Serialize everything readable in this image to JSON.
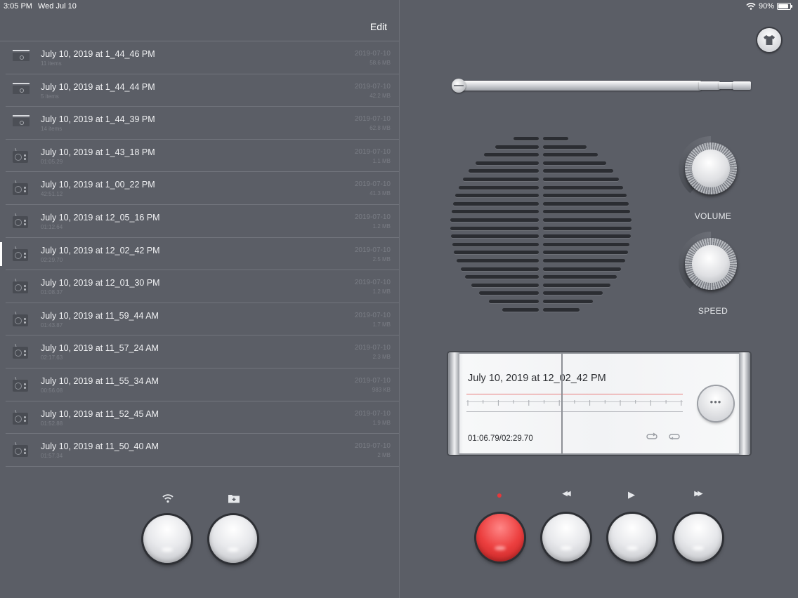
{
  "status": {
    "time": "3:05 PM",
    "date": "Wed Jul 10",
    "battery": "90%",
    "battery_level": 0.9
  },
  "left": {
    "edit_label": "Edit",
    "items": [
      {
        "type": "folder",
        "title": "July 10, 2019 at 1_44_46 PM",
        "sub": "11 items",
        "date": "2019-07-10",
        "size": "58.6 MB",
        "selected": false
      },
      {
        "type": "folder",
        "title": "July 10, 2019 at 1_44_44 PM",
        "sub": "5 items",
        "date": "2019-07-10",
        "size": "42.2 MB",
        "selected": false
      },
      {
        "type": "folder",
        "title": "July 10, 2019 at 1_44_39 PM",
        "sub": "14 items",
        "date": "2019-07-10",
        "size": "62.8 MB",
        "selected": false
      },
      {
        "type": "recording",
        "title": "July 10, 2019 at 1_43_18 PM",
        "sub": "01:05.29",
        "date": "2019-07-10",
        "size": "1.1 MB",
        "selected": false
      },
      {
        "type": "recording",
        "title": "July 10, 2019 at 1_00_22 PM",
        "sub": "42:51.12",
        "date": "2019-07-10",
        "size": "41.3 MB",
        "selected": false
      },
      {
        "type": "recording",
        "title": "July 10, 2019 at 12_05_16 PM",
        "sub": "01:12.64",
        "date": "2019-07-10",
        "size": "1.2 MB",
        "selected": false
      },
      {
        "type": "recording",
        "title": "July 10, 2019 at 12_02_42 PM",
        "sub": "02:29.70",
        "date": "2019-07-10",
        "size": "2.5 MB",
        "selected": true
      },
      {
        "type": "recording",
        "title": "July 10, 2019 at 12_01_30 PM",
        "sub": "01:08.37",
        "date": "2019-07-10",
        "size": "1.2 MB",
        "selected": false
      },
      {
        "type": "recording",
        "title": "July 10, 2019 at 11_59_44 AM",
        "sub": "01:43.87",
        "date": "2019-07-10",
        "size": "1.7 MB",
        "selected": false
      },
      {
        "type": "recording",
        "title": "July 10, 2019 at 11_57_24 AM",
        "sub": "02:17.63",
        "date": "2019-07-10",
        "size": "2.3 MB",
        "selected": false
      },
      {
        "type": "recording",
        "title": "July 10, 2019 at 11_55_34 AM",
        "sub": "00:56.08",
        "date": "2019-07-10",
        "size": "983 KB",
        "selected": false
      },
      {
        "type": "recording",
        "title": "July 10, 2019 at 11_52_45 AM",
        "sub": "01:52.88",
        "date": "2019-07-10",
        "size": "1.9 MB",
        "selected": false
      },
      {
        "type": "recording",
        "title": "July 10, 2019 at 11_50_40 AM",
        "sub": "01:57.34",
        "date": "2019-07-10",
        "size": "2 MB",
        "selected": false
      }
    ],
    "bottom_buttons": [
      {
        "name": "wifi-transfer",
        "icon": "wifi-icon"
      },
      {
        "name": "new-folder",
        "icon": "folder-add-icon"
      }
    ]
  },
  "right": {
    "knobs": {
      "volume_label": "VOLUME",
      "speed_label": "SPEED"
    },
    "display": {
      "title": "July 10, 2019 at 12_02_42 PM",
      "time": "01:06.79/02:29.70",
      "more_label": "•••"
    },
    "transport": [
      {
        "name": "record",
        "glyph": "●",
        "color": "#e5383b"
      },
      {
        "name": "rewind",
        "glyph": "◀◀"
      },
      {
        "name": "play",
        "glyph": "▶"
      },
      {
        "name": "fast-forward",
        "glyph": "▶▶"
      }
    ],
    "accent": "#ec3f3f"
  }
}
